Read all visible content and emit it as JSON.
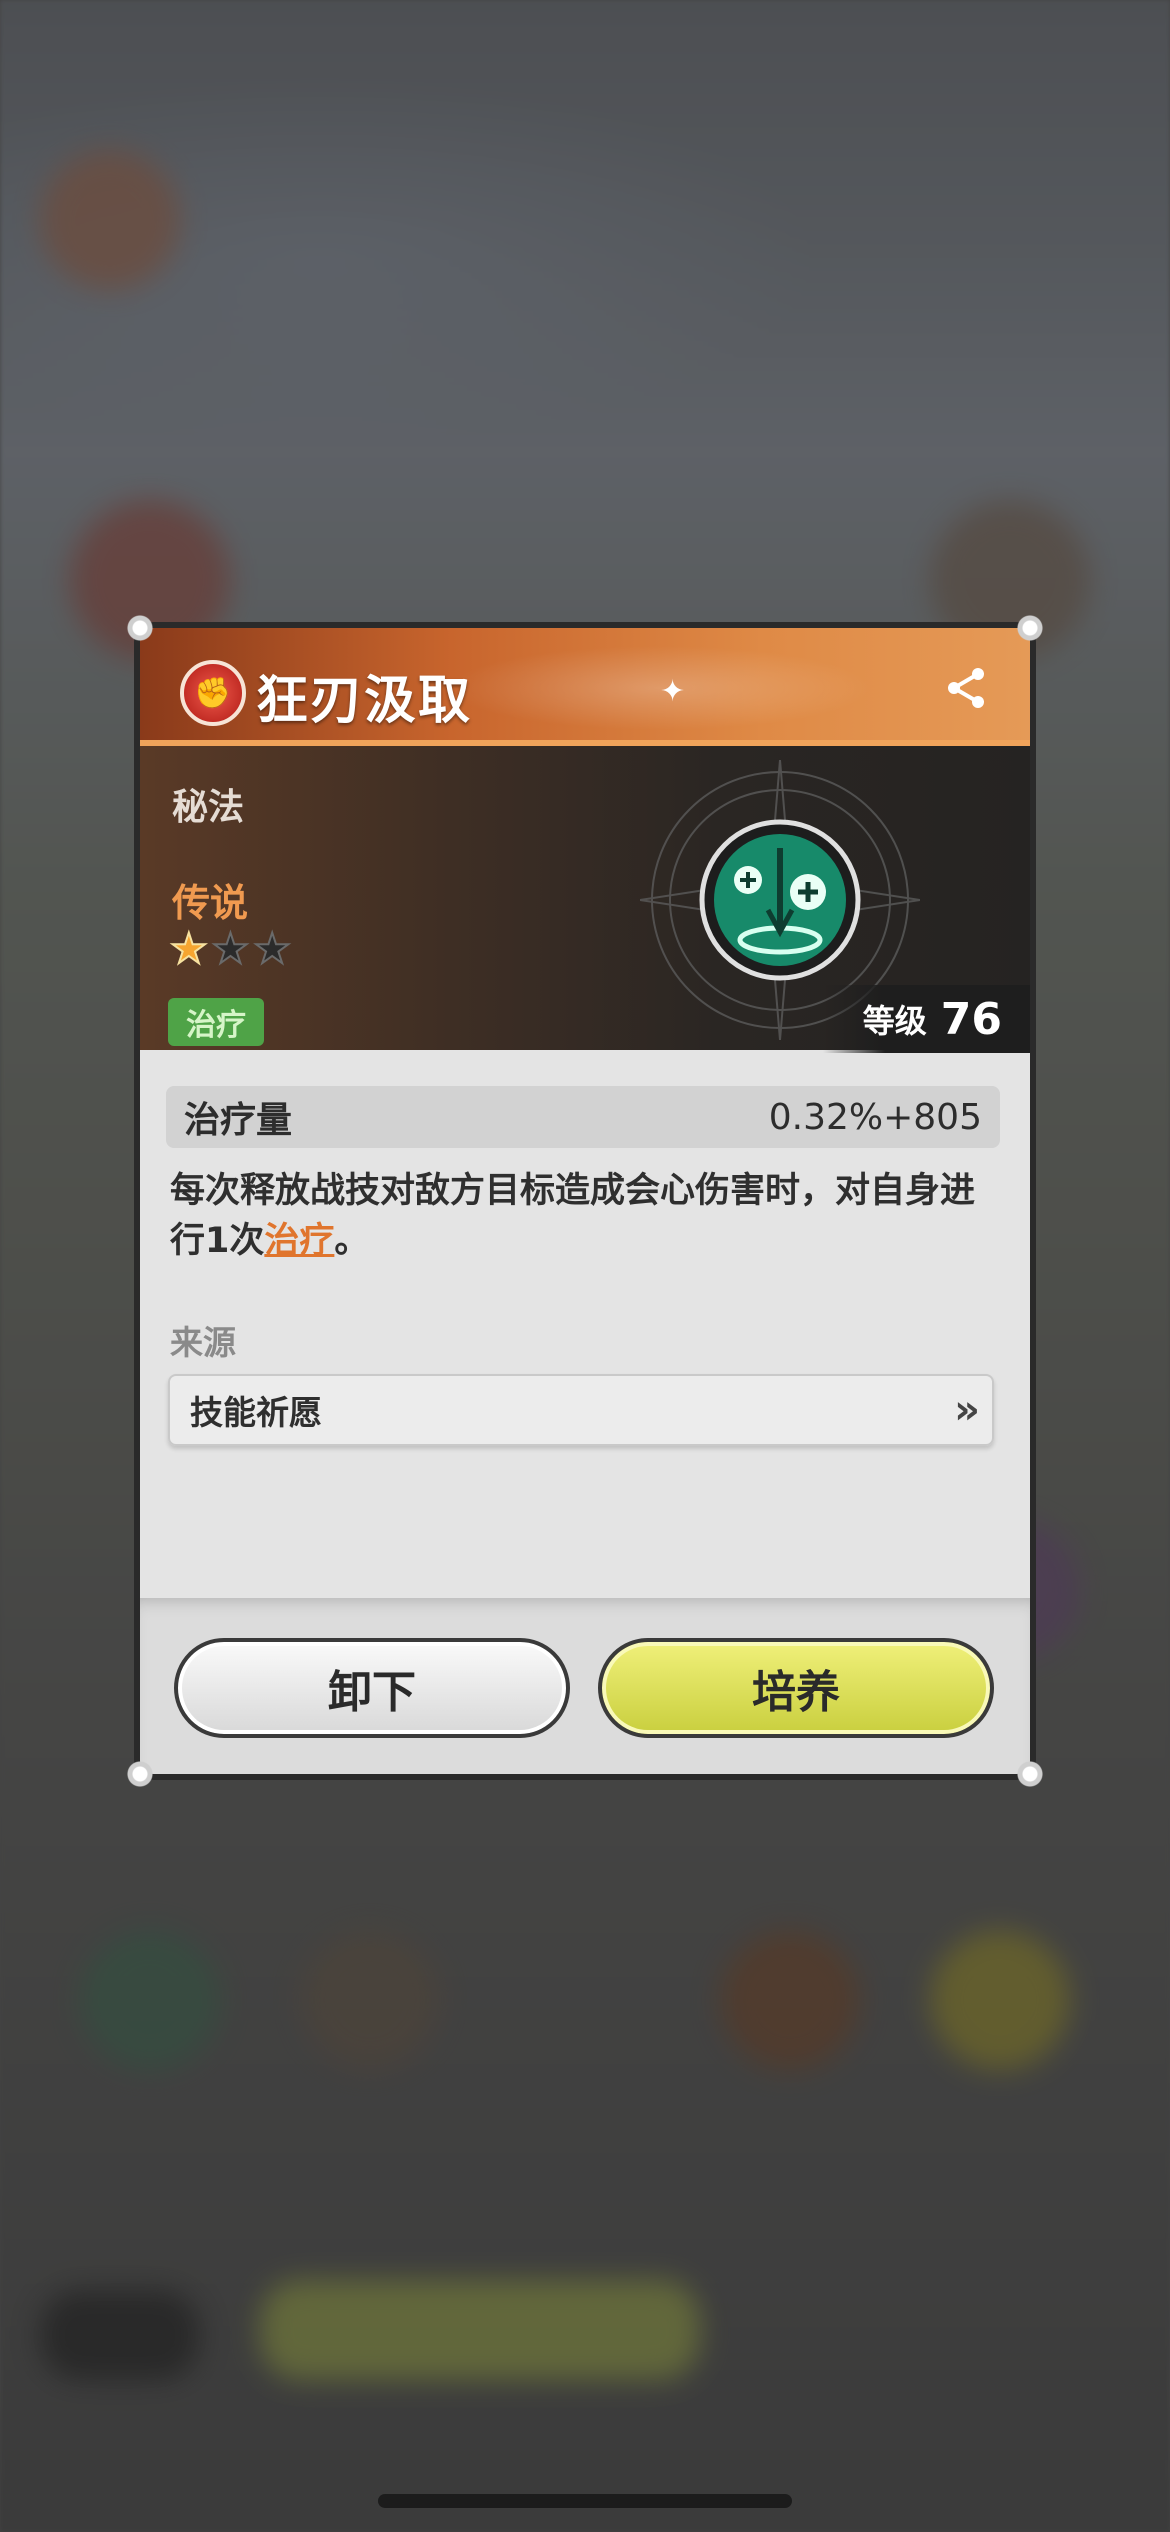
{
  "dialog": {
    "title": "狂刃汲取",
    "category": "秘法",
    "rarity": "传说",
    "stars": {
      "filled": 1,
      "total": 3
    },
    "tag": "治疗",
    "level_label": "等级",
    "level_value": "76",
    "stat": {
      "name": "治疗量",
      "value": "0.32%+805"
    },
    "description": {
      "before": "每次释放战技对敌方目标造成会心伤害时，对自身进行1次",
      "link": "治疗",
      "after": "。"
    },
    "source_label": "来源",
    "source_value": "技能祈愿",
    "source_chevron": "»",
    "buttons": {
      "unequip": "卸下",
      "train": "培养"
    }
  },
  "icons": {
    "title_icon": "fist-emblem-icon",
    "share": "share-icon",
    "skill": "healing-sword-icon"
  },
  "colors": {
    "header_orange": "#df8a46",
    "rarity_orange": "#f09a50",
    "tag_green": "#4fa347",
    "link_orange": "#e0752d",
    "train_button": "#d9df55"
  }
}
